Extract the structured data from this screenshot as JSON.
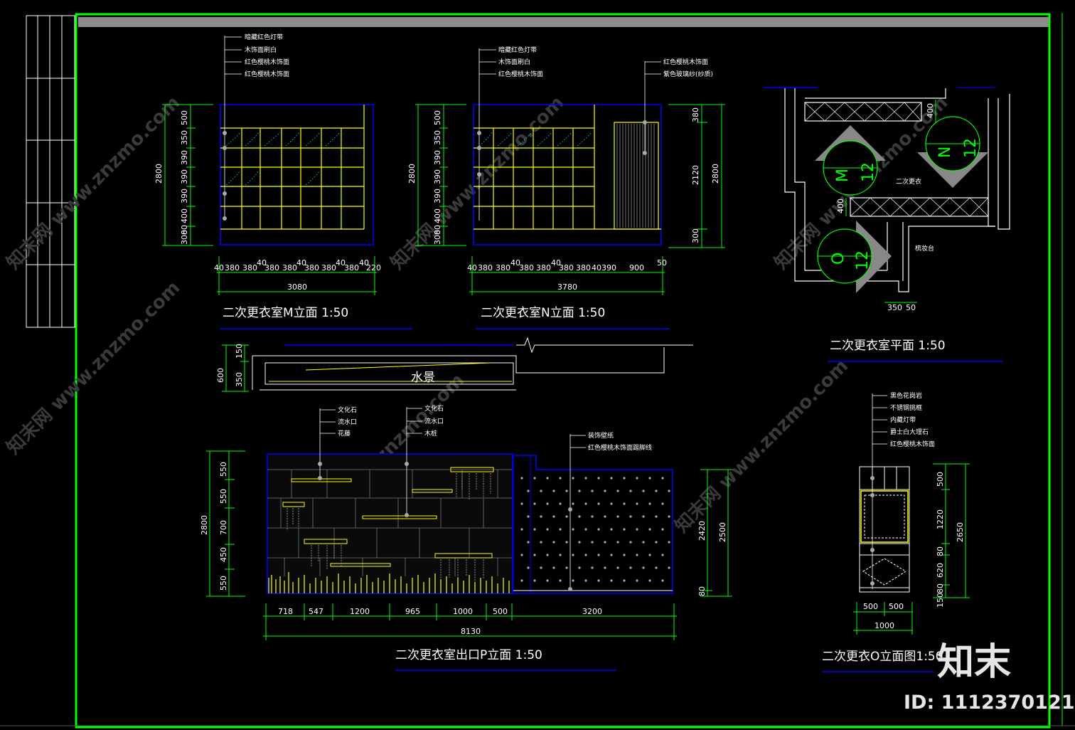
{
  "drawing": {
    "colors": {
      "background": "#000000",
      "frame": "#00ff00",
      "lines": "#ffff00",
      "dims": "#00ff00",
      "blue": "#0000ff",
      "text": "#ffffff"
    },
    "m_elevation": {
      "title": "二次更衣室M立面 1:50",
      "labels": [
        "暗藏红色灯带",
        "木饰面刷白",
        "红色樱桃木饰面",
        "红色樱桃木饰面"
      ],
      "height_total": "2800",
      "heights": [
        "500",
        "350",
        "390",
        "390",
        "390",
        "400",
        "80",
        "300"
      ],
      "widths": [
        "40",
        "380",
        "380",
        "40",
        "380",
        "380",
        "40",
        "380",
        "380",
        "40",
        "380",
        "40",
        "220"
      ],
      "width_total": "3080"
    },
    "n_elevation": {
      "title": "二次更衣室N立面 1:50",
      "labels": [
        "暗藏红色灯带",
        "木饰面刷白",
        "红色樱桃木饰面"
      ],
      "right_labels": [
        "红色樱桃木饰面",
        "紫色玻璃纱(纱质)"
      ],
      "height_total": "2800",
      "heights": [
        "500",
        "350",
        "390",
        "390",
        "390",
        "400",
        "80",
        "300"
      ],
      "right_heights": [
        "380",
        "2120",
        "300"
      ],
      "right_total": "2800",
      "widths": [
        "40",
        "380",
        "380",
        "40",
        "380",
        "380",
        "40",
        "380",
        "380",
        "40",
        "390",
        "900",
        "50"
      ],
      "width_total": "3780"
    },
    "plan": {
      "title": "二次更衣室平面 1:50",
      "room_label": "二次更衣",
      "counter_label": "梳妆台",
      "dims": [
        "400",
        "400",
        "350",
        "50"
      ],
      "markers": [
        {
          "letter": "M",
          "number": "12"
        },
        {
          "letter": "N",
          "number": "12"
        },
        {
          "letter": "O",
          "number": "12"
        }
      ]
    },
    "water_section": {
      "label": "水景",
      "dims": [
        "150",
        "350",
        "600"
      ]
    },
    "p_elevation": {
      "title": "二次更衣室出口P立面 1:50",
      "labels_a": [
        "文化石",
        "流水口",
        "花藤"
      ],
      "labels_b": [
        "文化石",
        "流水口",
        "木桩"
      ],
      "labels_c": [
        "装饰壁纸",
        "红色樱桃木饰面踢脚线"
      ],
      "heights": [
        "550",
        "550",
        "700",
        "450",
        "550"
      ],
      "height_total": "2800",
      "right_heights": [
        "2420",
        "80"
      ],
      "right_total": "2500",
      "widths": [
        "718",
        "547",
        "1200",
        "965",
        "1000",
        "500",
        "3200"
      ],
      "width_total": "8130"
    },
    "o_elevation": {
      "title": "二次更衣O立面图1:50",
      "labels": [
        "黑色花岗岩",
        "不锈钢挑框",
        "内藏灯带",
        "爵士白大理石",
        "红色樱桃木饰面"
      ],
      "heights": [
        "500",
        "1220",
        "80",
        "620",
        "80",
        "150"
      ],
      "height_total": "2650",
      "widths": [
        "500",
        "500"
      ],
      "width_total": "1000"
    },
    "watermarks": [
      "知末网 www.znzmo.com"
    ],
    "brand": {
      "logo": "知末",
      "id_text": "ID: 1112370121"
    }
  }
}
